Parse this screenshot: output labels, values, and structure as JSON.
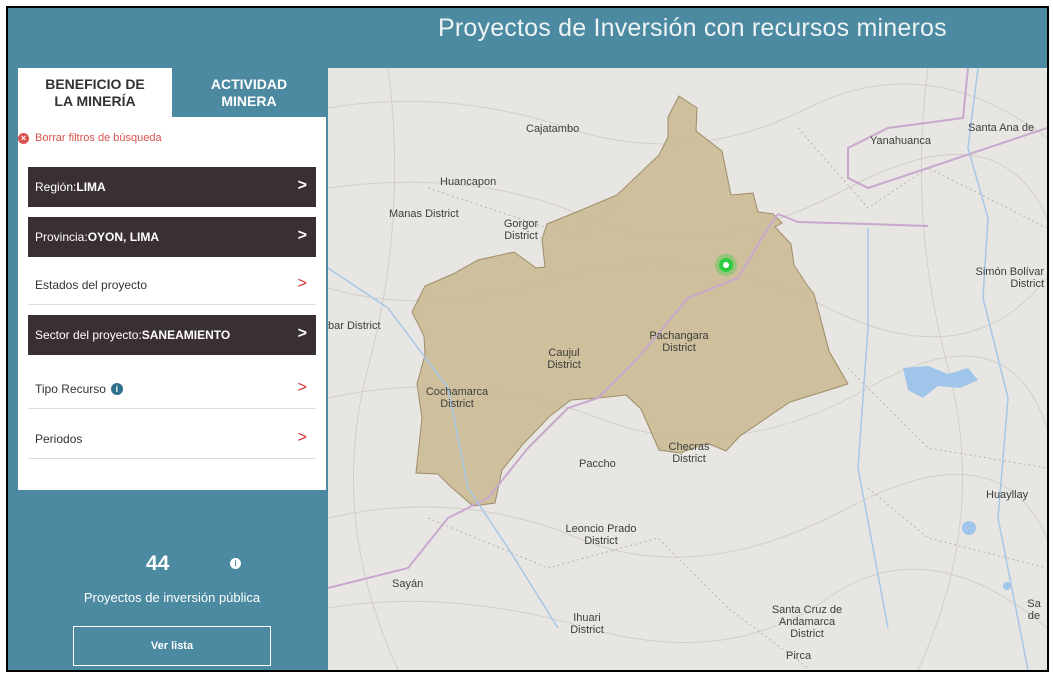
{
  "header": {
    "title": "Proyectos de Inversión con recursos mineros"
  },
  "tabs": [
    {
      "label": "BENEFICIO DE LA MINERÍA"
    },
    {
      "label": "ACTIVIDAD MINERA"
    }
  ],
  "filters": {
    "clear_label": "Borrar filtros de búsqueda",
    "items": [
      {
        "label": "Región: ",
        "value": "LIMA",
        "active": true
      },
      {
        "label": "Provincia: ",
        "value": "OYON, LIMA",
        "active": true
      },
      {
        "label": "Estados del proyecto",
        "value": "",
        "active": false
      },
      {
        "label": "Sector del proyecto: ",
        "value": "SANEAMIENTO",
        "active": true
      },
      {
        "label": "Tipo Recurso",
        "value": "",
        "active": false
      },
      {
        "label": "Periodos",
        "value": "",
        "active": false
      }
    ]
  },
  "summary": {
    "count": "44",
    "label": "Proyectos de inversión pública",
    "button_label": "Ver lista"
  },
  "map": {
    "labels": [
      "Cajatambo",
      "Yanahuanca",
      "Santa Ana de",
      "Huancapon",
      "Manas District",
      "Gorgor District",
      "Simón Bolívar District",
      "bar District",
      "Pachangara District",
      "Caujul District",
      "Cochamarca District",
      "Checras District",
      "Paccho",
      "Huayllay",
      "Leoncio Prado District",
      "Sayán",
      "Ihuari District",
      "Santa Cruz de Andamarca District",
      "Sa de",
      "Pirca"
    ]
  },
  "colors": {
    "header_bg": "#4b8aa0",
    "active_filter_bg": "#3b3031",
    "region_fill": "#c9b88f",
    "marker": "#2ecc40",
    "clear_filters": "#d9534f"
  }
}
